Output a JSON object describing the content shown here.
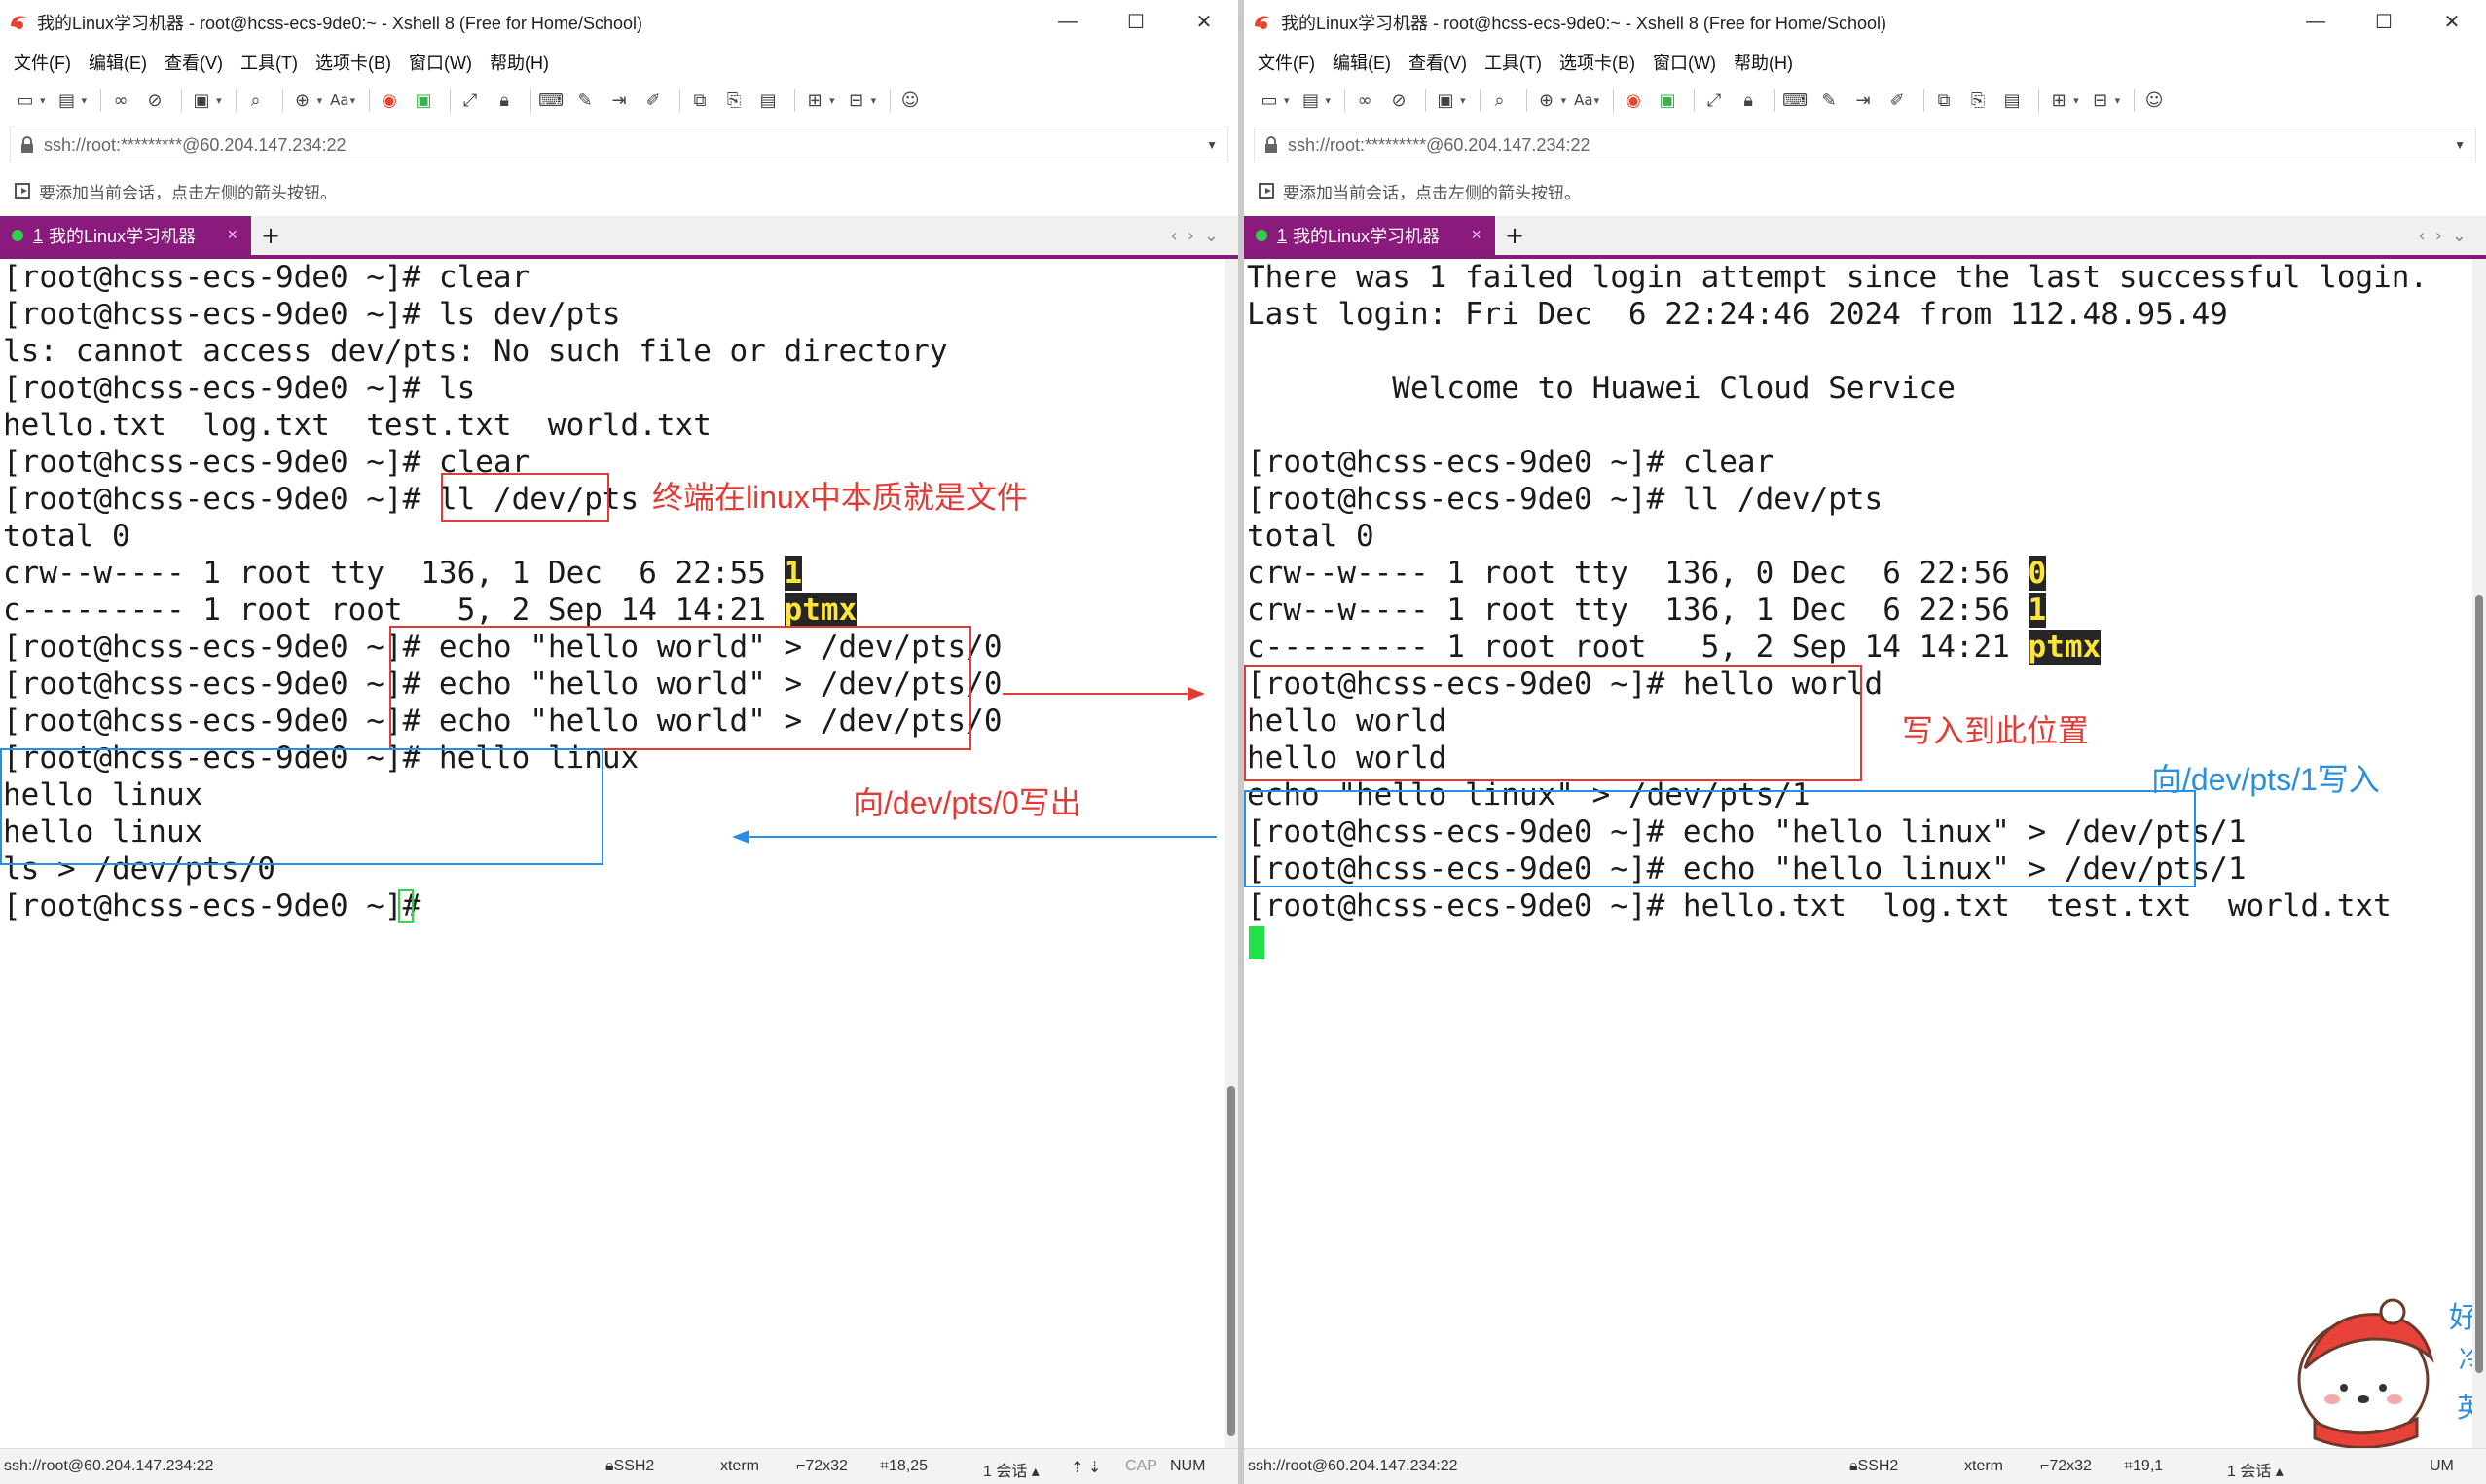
{
  "left": {
    "title": "我的Linux学习机器 - root@hcss-ecs-9de0:~ - Xshell 8 (Free for Home/School)",
    "menu": [
      "文件(F)",
      "编辑(E)",
      "查看(V)",
      "工具(T)",
      "选项卡(B)",
      "窗口(W)",
      "帮助(H)"
    ],
    "address": "ssh://root:*********@60.204.147.234:22",
    "hint": "要添加当前会话，点击左侧的箭头按钮。",
    "tab": {
      "num": "1",
      "label": "我的Linux学习机器",
      "close": "×"
    },
    "lines": [
      "[root@hcss-ecs-9de0 ~]# clear",
      "[root@hcss-ecs-9de0 ~]# ls dev/pts",
      "ls: cannot access dev/pts: No such file or directory",
      "[root@hcss-ecs-9de0 ~]# ls",
      "hello.txt  log.txt  test.txt  world.txt",
      "[root@hcss-ecs-9de0 ~]# clear",
      "[root@hcss-ecs-9de0 ~]# ll /dev/pts",
      "total 0",
      "crw--w---- 1 root tty  136, 1 Dec  6 22:55 ",
      "c--------- 1 root root   5, 2 Sep 14 14:21 ",
      "[root@hcss-ecs-9de0 ~]# echo \"hello world\" > /dev/pts/0",
      "[root@hcss-ecs-9de0 ~]# echo \"hello world\" > /dev/pts/0",
      "[root@hcss-ecs-9de0 ~]# echo \"hello world\" > /dev/pts/0",
      "[root@hcss-ecs-9de0 ~]# hello linux",
      "hello linux",
      "hello linux",
      "ls > /dev/pts/0",
      "[root@hcss-ecs-9de0 ~]# "
    ],
    "hl": [
      "1",
      "ptmx"
    ],
    "annotations": {
      "terminal_note": "终端在linux中本质就是文件",
      "write_out": "向/dev/pts/0写出"
    },
    "status": {
      "conn": "ssh://root@60.204.147.234:22",
      "proto": "SSH2",
      "term": "xterm",
      "size": "72x32",
      "pos": "18,25",
      "sessions": "1 会话",
      "cap": "CAP",
      "num": "NUM"
    }
  },
  "right": {
    "title": "我的Linux学习机器 - root@hcss-ecs-9de0:~ - Xshell 8 (Free for Home/School)",
    "menu": [
      "文件(F)",
      "编辑(E)",
      "查看(V)",
      "工具(T)",
      "选项卡(B)",
      "窗口(W)",
      "帮助(H)"
    ],
    "address": "ssh://root:*********@60.204.147.234:22",
    "hint": "要添加当前会话，点击左侧的箭头按钮。",
    "tab": {
      "num": "1",
      "label": "我的Linux学习机器",
      "close": "×"
    },
    "lines": [
      "There was 1 failed login attempt since the last successful login.",
      "Last login: Fri Dec  6 22:24:46 2024 from 112.48.95.49",
      "",
      "        Welcome to Huawei Cloud Service",
      "",
      "[root@hcss-ecs-9de0 ~]# clear",
      "[root@hcss-ecs-9de0 ~]# ll /dev/pts",
      "total 0",
      "crw--w---- 1 root tty  136, 0 Dec  6 22:56 ",
      "crw--w---- 1 root tty  136, 1 Dec  6 22:56 ",
      "c--------- 1 root root   5, 2 Sep 14 14:21 ",
      "[root@hcss-ecs-9de0 ~]# hello world",
      "hello world",
      "hello world",
      "echo \"hello linux\" > /dev/pts/1",
      "[root@hcss-ecs-9de0 ~]# echo \"hello linux\" > /dev/pts/1",
      "[root@hcss-ecs-9de0 ~]# echo \"hello linux\" > /dev/pts/1",
      "[root@hcss-ecs-9de0 ~]# hello.txt  log.txt  test.txt  world.txt"
    ],
    "hl": [
      "0",
      "1",
      "ptmx"
    ],
    "annotations": {
      "write_here": "写入到此位置",
      "write_to": "向/dev/pts/1写入"
    },
    "sticker_text": [
      "好",
      "冷",
      "英"
    ],
    "status": {
      "conn": "ssh://root@60.204.147.234:22",
      "proto": "SSH2",
      "term": "xterm",
      "size": "72x32",
      "pos": "19,1",
      "sessions": "1 会话",
      "num": "UM"
    }
  },
  "colors": {
    "tab_bg": "#8a1a7b",
    "annotation_red": "#e23b36",
    "annotation_blue": "#2a8fe0",
    "cursor_green": "#21e04a",
    "highlight_fg": "#ffe53a",
    "highlight_bg": "#262626"
  },
  "icons": [
    "xshell-logo-icon",
    "new-session-icon",
    "open-folder-icon",
    "reconnect-icon",
    "disconnect-icon",
    "new-window-icon",
    "search-icon",
    "globe-icon",
    "font-icon",
    "xshell-red-icon",
    "xftp-green-icon",
    "fullscreen-icon",
    "lock-icon",
    "compose-icon",
    "pencil-icon",
    "transfer-icon",
    "script-icon",
    "tunnel-icon",
    "add-icon",
    "layout-icon",
    "chat-icon",
    "minimize-icon",
    "maximize-icon",
    "close-icon"
  ]
}
